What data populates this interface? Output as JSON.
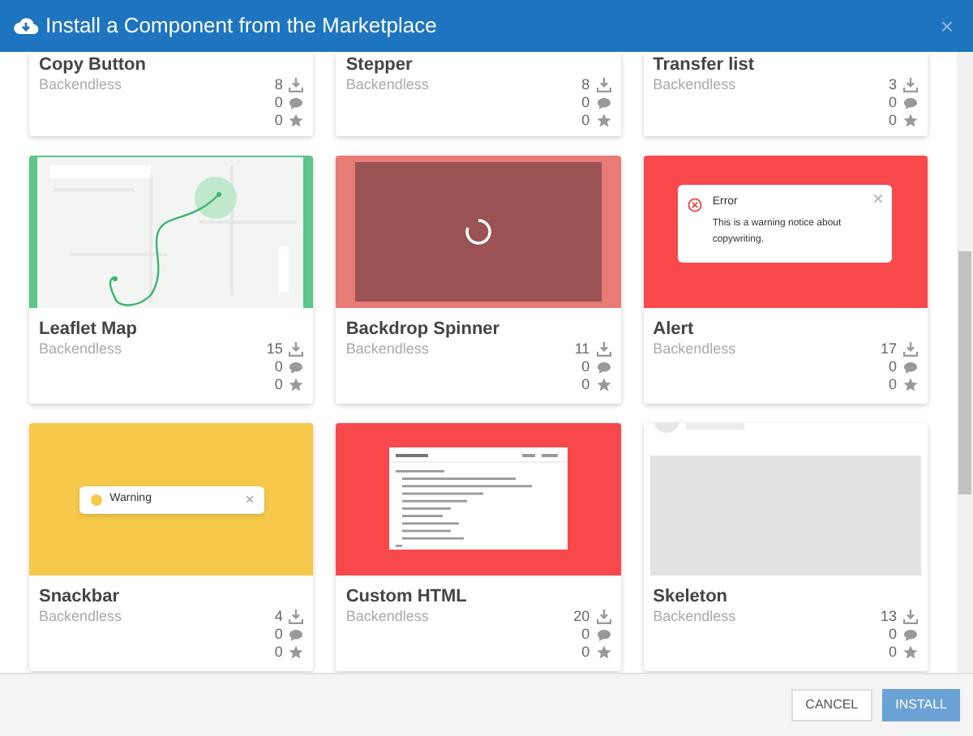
{
  "dialog": {
    "title": "Install a Component from the Marketplace",
    "close": "×"
  },
  "cards": [
    {
      "title": "Copy Button",
      "author": "Backendless",
      "downloads": "8",
      "comments": "0",
      "rating": "0"
    },
    {
      "title": "Stepper",
      "author": "Backendless",
      "downloads": "8",
      "comments": "0",
      "rating": "0"
    },
    {
      "title": "Transfer list",
      "author": "Backendless",
      "downloads": "3",
      "comments": "0",
      "rating": "0"
    },
    {
      "title": "Leaflet Map",
      "author": "Backendless",
      "downloads": "15",
      "comments": "0",
      "rating": "0",
      "preview": {
        "kind": "map"
      }
    },
    {
      "title": "Backdrop Spinner",
      "author": "Backendless",
      "downloads": "11",
      "comments": "0",
      "rating": "0",
      "preview": {
        "kind": "spinner"
      }
    },
    {
      "title": "Alert",
      "author": "Backendless",
      "downloads": "17",
      "comments": "0",
      "rating": "0",
      "preview": {
        "kind": "alert",
        "heading": "Error",
        "message": "This is a warning notice about copywriting."
      }
    },
    {
      "title": "Snackbar",
      "author": "Backendless",
      "downloads": "4",
      "comments": "0",
      "rating": "0",
      "preview": {
        "kind": "snackbar",
        "message": "Warning"
      }
    },
    {
      "title": "Custom HTML",
      "author": "Backendless",
      "downloads": "20",
      "comments": "0",
      "rating": "0",
      "preview": {
        "kind": "code"
      }
    },
    {
      "title": "Skeleton",
      "author": "Backendless",
      "downloads": "13",
      "comments": "0",
      "rating": "0",
      "preview": {
        "kind": "skeleton"
      }
    }
  ],
  "buttons": [
    {
      "label": "CANCEL",
      "kind": "secondary"
    },
    {
      "label": "INSTALL",
      "kind": "primary"
    }
  ]
}
